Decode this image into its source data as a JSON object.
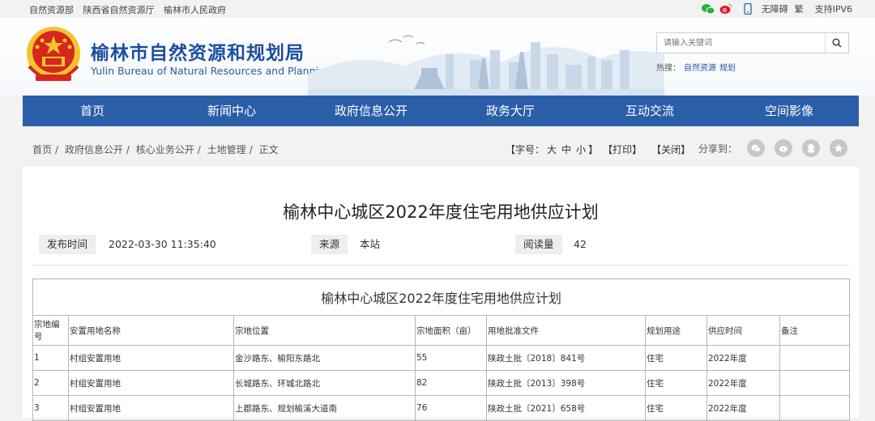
{
  "topbar": {
    "links": [
      "自然资源部",
      "陕西省自然资源厅",
      "榆林市人民政府"
    ],
    "access": "无障碍",
    "traditional": "繁",
    "ipv6": "支持IPV6"
  },
  "header": {
    "title_cn": "榆林市自然资源和规划局",
    "title_en": "Yulin Bureau of Natural Resources and Planning",
    "search_placeholder": "请输入关键词",
    "hot_label": "热搜：",
    "hot_links": [
      "自然资源",
      "规划"
    ]
  },
  "nav": [
    "首页",
    "新闻中心",
    "政府信息公开",
    "政务大厅",
    "互动交流",
    "空间影像"
  ],
  "breadcrumb": [
    "首页",
    "政府信息公开",
    "核心业务公开",
    "土地管理",
    "正文"
  ],
  "tools": {
    "font_open": "【字号：",
    "sizes": [
      "大",
      "中",
      "小"
    ],
    "font_close": "】",
    "print": "【打印】",
    "close": "【关闭】",
    "share": "分享到："
  },
  "article": {
    "title": "榆林中心城区2022年度住宅用地供应计划",
    "publish_label": "发布时间",
    "publish_value": "2022-03-30 11:35:40",
    "source_label": "来源",
    "source_value": "本站",
    "reads_label": "阅读量",
    "reads_value": "42"
  },
  "table": {
    "caption": "榆林中心城区2022年度住宅用地供应计划",
    "headers": [
      "宗地编号",
      "安置用地名称",
      "宗地位置",
      "宗地面积（亩）",
      "用地批准文件",
      "规划用途",
      "供应时间",
      "备注"
    ],
    "rows": [
      [
        "1",
        "村组安置用地",
        "金沙路东、榆阳东路北",
        "55",
        "陕政土批〔2018〕841号",
        "住宅",
        "2022年度",
        ""
      ],
      [
        "2",
        "村组安置用地",
        "长城路东、环城北路北",
        "82",
        "陕政土批〔2013〕398号",
        "住宅",
        "2022年度",
        ""
      ],
      [
        "3",
        "村组安置用地",
        "上郡路东、规划榆溪大道南",
        "76",
        "陕政土批〔2021〕658号",
        "住宅",
        "2022年度",
        ""
      ]
    ]
  },
  "colors": {
    "nav_bg": "#2b5ea8",
    "title_blue": "#1b4ea0",
    "emblem_red": "#d7261e",
    "emblem_gold": "#f4c430"
  },
  "icons": [
    "wechat-icon",
    "weibo-icon",
    "mobile-icon",
    "search-icon",
    "share-wechat-icon",
    "share-weibo-icon",
    "share-qq-icon",
    "share-qzone-icon"
  ]
}
